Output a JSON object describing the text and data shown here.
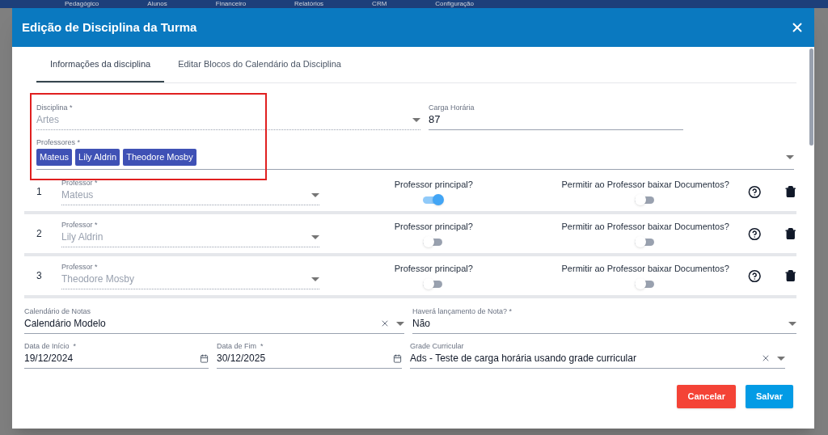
{
  "background": {
    "nav": [
      "Pedagógico",
      "Alunos",
      "Financeiro",
      "Relatórios",
      "CRM",
      "Configuração"
    ]
  },
  "dialog": {
    "title": "Edição de Disciplina da Turma",
    "tabs": [
      {
        "label": "Informações da disciplina",
        "selected": true
      },
      {
        "label": "Editar Blocos do Calendário da Disciplina",
        "selected": false
      }
    ],
    "disciplina": {
      "label": "Disciplina *",
      "value": "Artes",
      "disabled": true
    },
    "carga_horaria": {
      "label": "Carga Horária",
      "value": "87"
    },
    "professores": {
      "label": "Professores *",
      "chips": [
        "Mateus",
        "Lily Aldrin",
        "Theodore Mosby"
      ],
      "highlighted": true
    },
    "professor_rows": [
      {
        "number": "1",
        "label": "Professor *",
        "value": "Mateus",
        "disabled": true,
        "principal_label": "Professor principal?",
        "principal_on": true,
        "download_label": "Permitir ao Professor baixar Documentos?",
        "download_on": false
      },
      {
        "number": "2",
        "label": "Professor *",
        "value": "Lily Aldrin",
        "disabled": true,
        "principal_label": "Professor principal?",
        "principal_on": false,
        "download_label": "Permitir ao Professor baixar Documentos?",
        "download_on": false
      },
      {
        "number": "3",
        "label": "Professor *",
        "value": "Theodore Mosby",
        "disabled": true,
        "principal_label": "Professor principal?",
        "principal_on": false,
        "download_label": "Permitir ao Professor baixar Documentos?",
        "download_on": false
      }
    ],
    "calendario": {
      "label": "Calendário de Notas",
      "value": "Calendário Modelo"
    },
    "lancamento": {
      "label": "Haverá lançamento de Nota? *",
      "value": "Não"
    },
    "data_inicio": {
      "label": "Data de Início  *",
      "value": "19/12/2024"
    },
    "data_fim": {
      "label": "Data de Fim  *",
      "value": "30/12/2025"
    },
    "grade": {
      "label": "Grade Curricular",
      "value": "Ads - Teste de carga horária usando grade curricular"
    },
    "buttons": [
      {
        "label": "Cancelar",
        "kind": "cancel"
      },
      {
        "label": "Salvar",
        "kind": "save"
      }
    ]
  }
}
